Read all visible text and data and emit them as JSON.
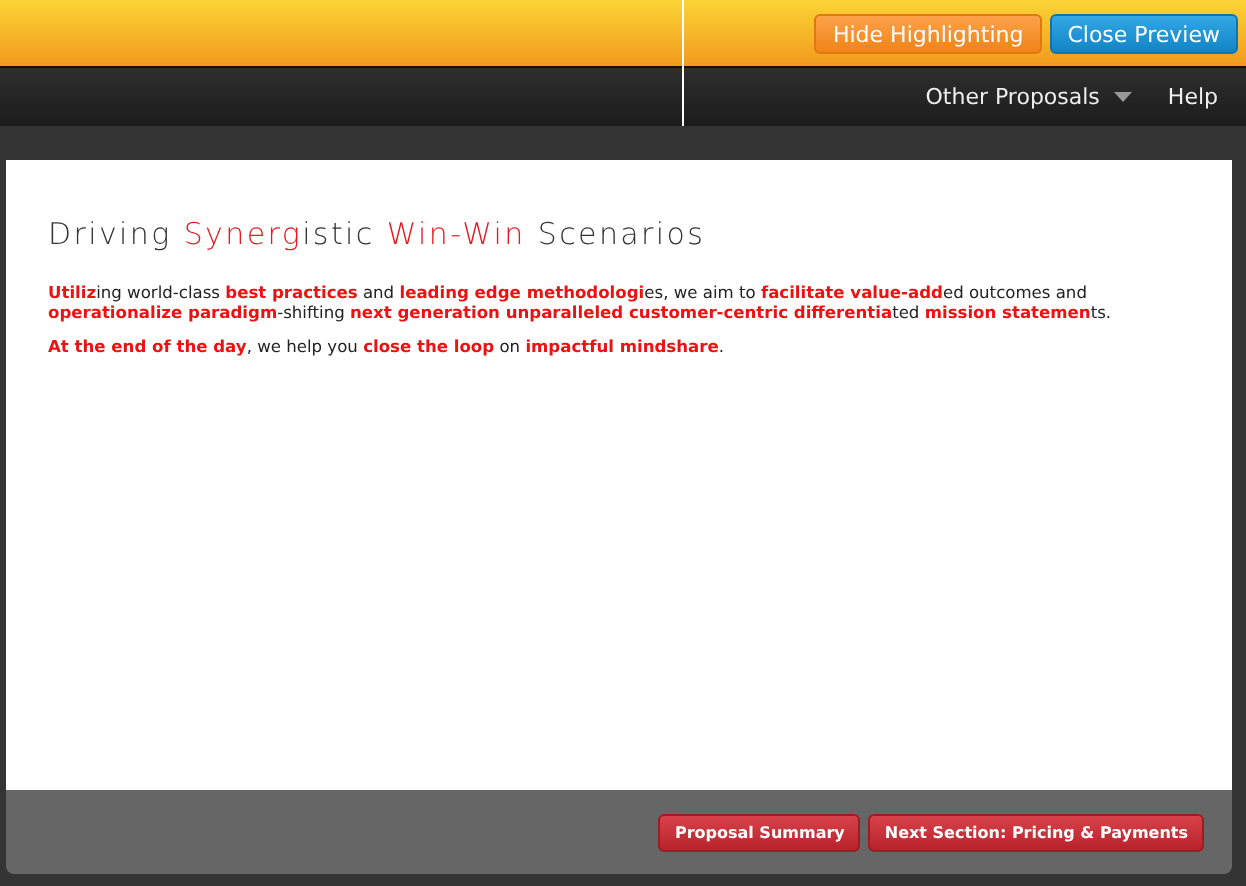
{
  "top_bar": {
    "buttons": [
      {
        "label": "Hide Highlighting",
        "kind": "orange"
      },
      {
        "label": "Close Preview",
        "kind": "blue"
      }
    ]
  },
  "nav": {
    "items": [
      {
        "label": "Other Proposals",
        "kind": "dropdown"
      },
      {
        "label": "Help",
        "kind": "link"
      }
    ]
  },
  "document": {
    "title": "Driving **Synerg**istic **Win-Win** Scenarios",
    "paragraphs": [
      "**Utiliz**ing world-class **best practices** and **leading edge methodologi**es, we aim to **facilitate value-add**ed outcomes and **operationalize paradigm**-shifting **next generation unparalleled customer-centric differentia**ted **mission statemen**ts.",
      "**At the end of the day**, we help you **close the loop** on **impactful mindshare**."
    ]
  },
  "footer": {
    "buttons": [
      "Proposal Summary",
      "Next Section: Pricing & Payments"
    ]
  }
}
